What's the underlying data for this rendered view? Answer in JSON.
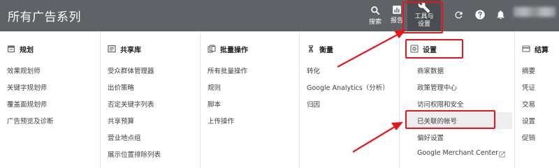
{
  "app": {
    "title": "所有广告系列"
  },
  "toolbar": {
    "search_label": "搜索",
    "reports_label": "报告",
    "tools_label_line1": "工具与",
    "tools_label_line2": "设置"
  },
  "columns": [
    {
      "id": "planning",
      "header": "规划",
      "icon": "calendar-icon",
      "items": [
        "效果规划师",
        "关键字规划师",
        "覆盖面规划师",
        "广告预览及诊断"
      ]
    },
    {
      "id": "shared_library",
      "header": "共享库",
      "icon": "library-icon",
      "items": [
        "受众群体管理器",
        "出价策略",
        "否定关键字列表",
        "共享预算",
        "营业地点组",
        "展示位置排除列表"
      ]
    },
    {
      "id": "bulk_actions",
      "header": "批量操作",
      "icon": "bulk-copy-icon",
      "items": [
        "所有批量操作",
        "规则",
        "脚本",
        "上传操作"
      ]
    },
    {
      "id": "measurement",
      "header": "衡量",
      "icon": "hourglass-icon",
      "items": [
        "转化",
        "Google Analytics（分析）",
        "归因"
      ]
    },
    {
      "id": "setup",
      "header": "设置",
      "icon": "settings-box-icon",
      "items": [
        "商家数据",
        "政策管理中心",
        "访问权限和安全",
        "已关联的帐号",
        "偏好设置",
        "Google Merchant Center"
      ]
    },
    {
      "id": "billing",
      "header": "结算",
      "icon": "billing-icon",
      "items": [
        "摘要",
        "凭证",
        "交易",
        "设置",
        "促销"
      ]
    }
  ],
  "highlight": {
    "color": "#e8141b",
    "boxed": [
      "工具与设置",
      "设置",
      "已关联的帐号"
    ]
  },
  "colors": {
    "topbar": "#5f6368",
    "text": "#3c4043",
    "divider": "#e3e3e3"
  }
}
